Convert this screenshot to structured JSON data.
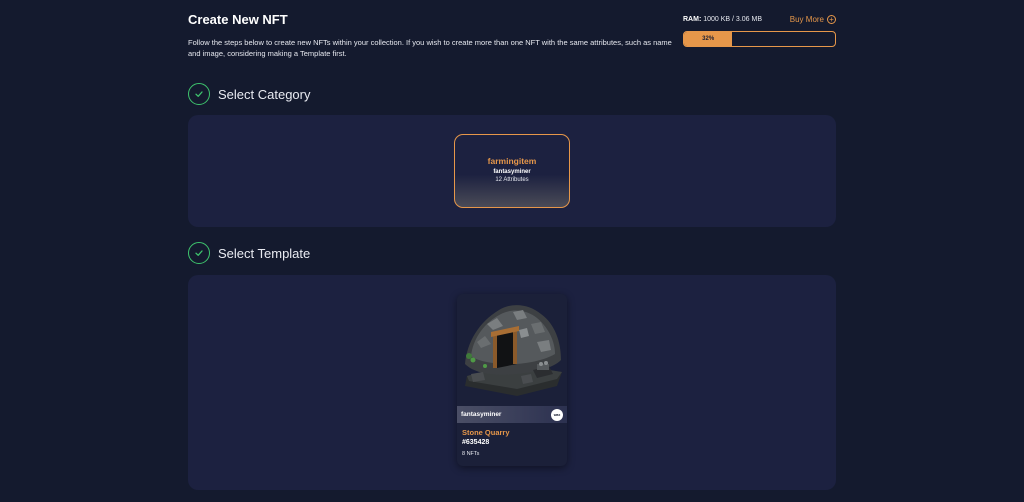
{
  "header": {
    "title": "Create New NFT",
    "intro": "Follow the steps below to create new NFTs within your collection. If you wish to create more than one NFT with the same attributes, such as name and image, considering making a Template first."
  },
  "ram": {
    "label": "RAM:",
    "usage": "1000 KB / 3.06 MB",
    "buy_more_label": "Buy More",
    "percent_label": "32%",
    "percent": 32
  },
  "steps": [
    {
      "label": "Select Category"
    },
    {
      "label": "Select Template"
    }
  ],
  "category_card": {
    "name": "farmingitem",
    "author": "fantasyminer",
    "attributes": "12 Attributes"
  },
  "template_card": {
    "author": "fantasyminer",
    "name": "Stone Quarry",
    "id": "#635428",
    "count": "8 NFTs"
  },
  "colors": {
    "background": "#141a2e",
    "panel": "#1c2140",
    "accent": "#e6974a",
    "success": "#3ec46d"
  }
}
